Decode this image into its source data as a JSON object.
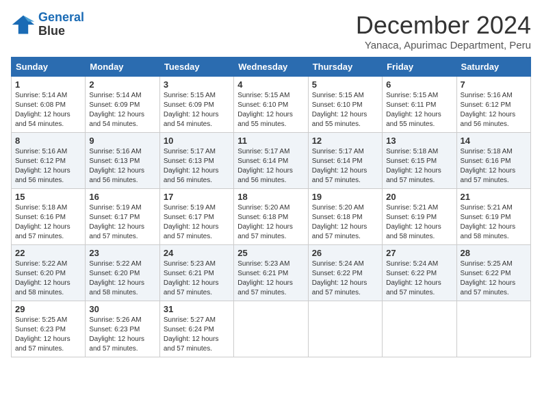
{
  "logo": {
    "line1": "General",
    "line2": "Blue"
  },
  "title": "December 2024",
  "subtitle": "Yanaca, Apurimac Department, Peru",
  "weekdays": [
    "Sunday",
    "Monday",
    "Tuesday",
    "Wednesday",
    "Thursday",
    "Friday",
    "Saturday"
  ],
  "weeks": [
    [
      {
        "day": "1",
        "sunrise": "5:14 AM",
        "sunset": "6:08 PM",
        "daylight": "12 hours and 54 minutes."
      },
      {
        "day": "2",
        "sunrise": "5:14 AM",
        "sunset": "6:09 PM",
        "daylight": "12 hours and 54 minutes."
      },
      {
        "day": "3",
        "sunrise": "5:15 AM",
        "sunset": "6:09 PM",
        "daylight": "12 hours and 54 minutes."
      },
      {
        "day": "4",
        "sunrise": "5:15 AM",
        "sunset": "6:10 PM",
        "daylight": "12 hours and 55 minutes."
      },
      {
        "day": "5",
        "sunrise": "5:15 AM",
        "sunset": "6:10 PM",
        "daylight": "12 hours and 55 minutes."
      },
      {
        "day": "6",
        "sunrise": "5:15 AM",
        "sunset": "6:11 PM",
        "daylight": "12 hours and 55 minutes."
      },
      {
        "day": "7",
        "sunrise": "5:16 AM",
        "sunset": "6:12 PM",
        "daylight": "12 hours and 56 minutes."
      }
    ],
    [
      {
        "day": "8",
        "sunrise": "5:16 AM",
        "sunset": "6:12 PM",
        "daylight": "12 hours and 56 minutes."
      },
      {
        "day": "9",
        "sunrise": "5:16 AM",
        "sunset": "6:13 PM",
        "daylight": "12 hours and 56 minutes."
      },
      {
        "day": "10",
        "sunrise": "5:17 AM",
        "sunset": "6:13 PM",
        "daylight": "12 hours and 56 minutes."
      },
      {
        "day": "11",
        "sunrise": "5:17 AM",
        "sunset": "6:14 PM",
        "daylight": "12 hours and 56 minutes."
      },
      {
        "day": "12",
        "sunrise": "5:17 AM",
        "sunset": "6:14 PM",
        "daylight": "12 hours and 57 minutes."
      },
      {
        "day": "13",
        "sunrise": "5:18 AM",
        "sunset": "6:15 PM",
        "daylight": "12 hours and 57 minutes."
      },
      {
        "day": "14",
        "sunrise": "5:18 AM",
        "sunset": "6:16 PM",
        "daylight": "12 hours and 57 minutes."
      }
    ],
    [
      {
        "day": "15",
        "sunrise": "5:18 AM",
        "sunset": "6:16 PM",
        "daylight": "12 hours and 57 minutes."
      },
      {
        "day": "16",
        "sunrise": "5:19 AM",
        "sunset": "6:17 PM",
        "daylight": "12 hours and 57 minutes."
      },
      {
        "day": "17",
        "sunrise": "5:19 AM",
        "sunset": "6:17 PM",
        "daylight": "12 hours and 57 minutes."
      },
      {
        "day": "18",
        "sunrise": "5:20 AM",
        "sunset": "6:18 PM",
        "daylight": "12 hours and 57 minutes."
      },
      {
        "day": "19",
        "sunrise": "5:20 AM",
        "sunset": "6:18 PM",
        "daylight": "12 hours and 57 minutes."
      },
      {
        "day": "20",
        "sunrise": "5:21 AM",
        "sunset": "6:19 PM",
        "daylight": "12 hours and 58 minutes."
      },
      {
        "day": "21",
        "sunrise": "5:21 AM",
        "sunset": "6:19 PM",
        "daylight": "12 hours and 58 minutes."
      }
    ],
    [
      {
        "day": "22",
        "sunrise": "5:22 AM",
        "sunset": "6:20 PM",
        "daylight": "12 hours and 58 minutes."
      },
      {
        "day": "23",
        "sunrise": "5:22 AM",
        "sunset": "6:20 PM",
        "daylight": "12 hours and 58 minutes."
      },
      {
        "day": "24",
        "sunrise": "5:23 AM",
        "sunset": "6:21 PM",
        "daylight": "12 hours and 57 minutes."
      },
      {
        "day": "25",
        "sunrise": "5:23 AM",
        "sunset": "6:21 PM",
        "daylight": "12 hours and 57 minutes."
      },
      {
        "day": "26",
        "sunrise": "5:24 AM",
        "sunset": "6:22 PM",
        "daylight": "12 hours and 57 minutes."
      },
      {
        "day": "27",
        "sunrise": "5:24 AM",
        "sunset": "6:22 PM",
        "daylight": "12 hours and 57 minutes."
      },
      {
        "day": "28",
        "sunrise": "5:25 AM",
        "sunset": "6:22 PM",
        "daylight": "12 hours and 57 minutes."
      }
    ],
    [
      {
        "day": "29",
        "sunrise": "5:25 AM",
        "sunset": "6:23 PM",
        "daylight": "12 hours and 57 minutes."
      },
      {
        "day": "30",
        "sunrise": "5:26 AM",
        "sunset": "6:23 PM",
        "daylight": "12 hours and 57 minutes."
      },
      {
        "day": "31",
        "sunrise": "5:27 AM",
        "sunset": "6:24 PM",
        "daylight": "12 hours and 57 minutes."
      },
      null,
      null,
      null,
      null
    ]
  ]
}
